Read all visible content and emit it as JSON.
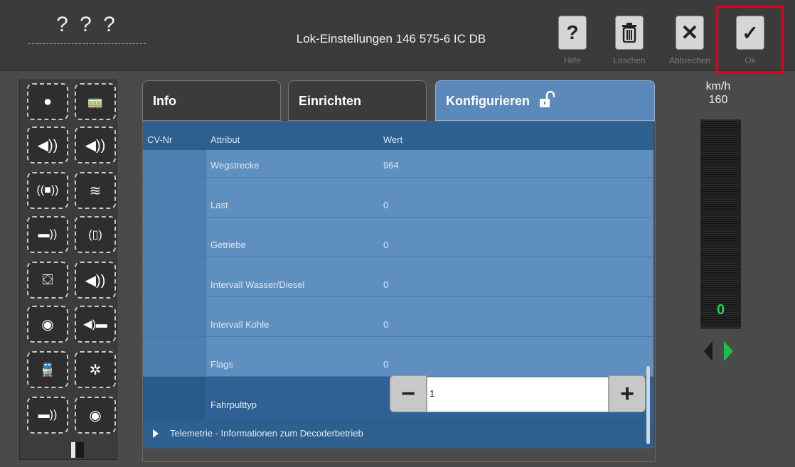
{
  "header": {
    "loco_name": "? ? ?",
    "title": "Lok-Einstellungen 146 575-6 IC DB",
    "buttons": [
      {
        "icon": "question-icon",
        "label": "Hilfe"
      },
      {
        "icon": "trash-icon",
        "label": "Löschen"
      },
      {
        "icon": "close-icon",
        "label": "Abbrechen"
      },
      {
        "icon": "check-icon",
        "label": "Ok"
      }
    ],
    "highlight_color": "#e0001a"
  },
  "tabs": [
    {
      "label": "Info",
      "active": false
    },
    {
      "label": "Einrichten",
      "active": false
    },
    {
      "label": "Konfigurieren",
      "active": true,
      "icon": "unlock-icon"
    }
  ],
  "table": {
    "columns": [
      "CV-Nr",
      "Attribut",
      "Wert"
    ],
    "rows": [
      {
        "cv": "",
        "attribute": "Wegstrecke",
        "value": "964"
      },
      {
        "cv": "",
        "attribute": "Last",
        "value": "0"
      },
      {
        "cv": "",
        "attribute": "Getriebe",
        "value": "0"
      },
      {
        "cv": "",
        "attribute": "Intervall Wasser/Diesel",
        "value": "0"
      },
      {
        "cv": "",
        "attribute": "Intervall Kohle",
        "value": "0"
      },
      {
        "cv": "",
        "attribute": "Flags",
        "value": "0"
      },
      {
        "cv": "",
        "attribute": "Fahrpulttyp",
        "value": "1"
      }
    ],
    "expander_label": "Telemetrie - Informationen zum Decoderbetrieb",
    "active_color": "#5b89b9"
  },
  "speed": {
    "unit": "km/h",
    "max": "160",
    "current": "0",
    "direction": "forward"
  },
  "functions": [
    "light-icon",
    "locomotive-icon",
    "horn-icon",
    "sound-icon",
    "cab-sound-icon",
    "steam-icon",
    "whistle-icon",
    "door-sound-icon",
    "weight-icon",
    "announcement-icon",
    "radio-icon",
    "coupling-sound-icon",
    "train-icon",
    "fan-icon",
    "horn2-icon",
    "radio2-icon"
  ]
}
